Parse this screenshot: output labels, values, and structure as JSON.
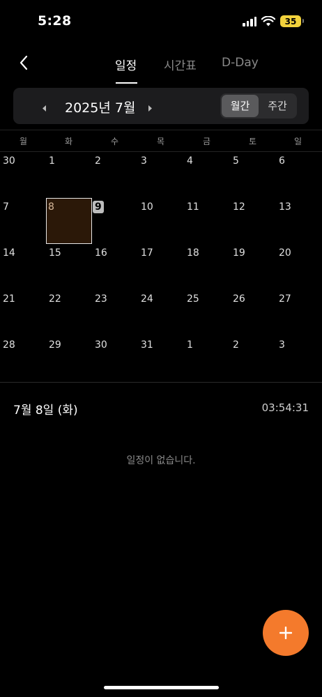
{
  "status_bar": {
    "time": "5:28",
    "battery": "35"
  },
  "nav": {
    "tabs": [
      "일정",
      "시간표",
      "D-Day"
    ],
    "active_tab": 0
  },
  "month_selector": {
    "title": "2025년 7월",
    "view_options": [
      "월간",
      "주간"
    ],
    "active_view": 0
  },
  "calendar": {
    "weekdays": [
      "월",
      "화",
      "수",
      "목",
      "금",
      "토",
      "일"
    ],
    "weeks": [
      [
        "30",
        "1",
        "2",
        "3",
        "4",
        "5",
        "6"
      ],
      [
        "7",
        "8",
        "9",
        "10",
        "11",
        "12",
        "13"
      ],
      [
        "14",
        "15",
        "16",
        "17",
        "18",
        "19",
        "20"
      ],
      [
        "21",
        "22",
        "23",
        "24",
        "25",
        "26",
        "27"
      ],
      [
        "28",
        "29",
        "30",
        "31",
        "1",
        "2",
        "3"
      ]
    ],
    "selected_date": "8",
    "today_date": "9"
  },
  "selected_day": {
    "date_label": "7월 8일 (화)",
    "clock": "03:54:31",
    "empty_message": "일정이 없습니다."
  },
  "colors": {
    "accent": "#f47a2c",
    "selected_cell_bg": "#2b1808",
    "toggle_active": "#5a5a5c"
  },
  "icons": {
    "back": "chevron-left-icon",
    "prev": "caret-left-icon",
    "next": "caret-right-icon",
    "add": "plus-icon"
  }
}
